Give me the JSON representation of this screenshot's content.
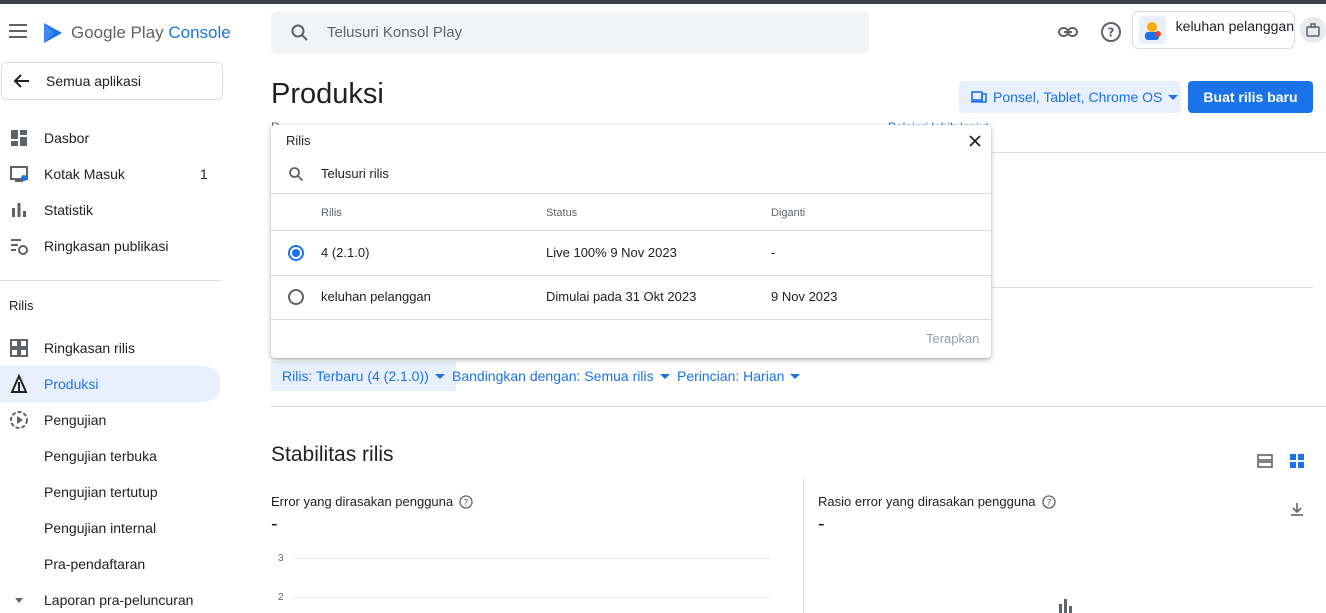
{
  "app": {
    "logo_text_main": "Google Play",
    "logo_text_accent": "Console"
  },
  "search": {
    "placeholder": "Telusuri Konsol Play"
  },
  "account": {
    "name": "keluhan pelanggan"
  },
  "sidebar": {
    "back_label": "Semua aplikasi",
    "items": [
      {
        "label": "Dasbor",
        "icon": "dashboard-icon"
      },
      {
        "label": "Kotak Masuk",
        "icon": "inbox-icon",
        "count": "1"
      },
      {
        "label": "Statistik",
        "icon": "statistics-icon"
      },
      {
        "label": "Ringkasan publikasi",
        "icon": "publishing-overview-icon"
      }
    ],
    "section_label": "Rilis",
    "release_items": [
      {
        "label": "Ringkasan rilis",
        "icon": "release-overview-icon"
      },
      {
        "label": "Produksi",
        "icon": "production-icon",
        "active": true
      },
      {
        "label": "Pengujian",
        "icon": "testing-icon"
      },
      {
        "label": "Pengujian terbuka"
      },
      {
        "label": "Pengujian tertutup"
      },
      {
        "label": "Pengujian internal"
      },
      {
        "label": "Pra-pendaftaran"
      },
      {
        "label": "Laporan pra-peluncuran",
        "icon": "expand-chevron-icon"
      }
    ]
  },
  "main": {
    "title": "Produksi",
    "device_filter": "Ponsel, Tablet, Chrome OS",
    "create_button": "Buat rilis baru",
    "description_fragment": "R",
    "description_link": "Pelajari lebih lanjut",
    "filters": [
      {
        "label": "Rilis: Terbaru (4 (2.1.0))",
        "selected": true
      },
      {
        "label": "Bandingkan dengan: Semua rilis"
      },
      {
        "label": "Perincian: Harian"
      }
    ],
    "section_title": "Stabilitas rilis",
    "metrics": [
      {
        "label": "Error yang dirasakan pengguna",
        "value": "-"
      },
      {
        "label": "Rasio error yang dirasakan pengguna",
        "value": "-"
      }
    ],
    "chart_ticks": [
      "3",
      "2"
    ]
  },
  "dropdown": {
    "title": "Rilis",
    "search_text": "Telusuri rilis",
    "columns": [
      "Rilis",
      "Status",
      "Diganti"
    ],
    "rows": [
      {
        "release": "4 (2.1.0)",
        "status": "Live 100% 9 Nov 2023",
        "replaced": "-",
        "selected": true
      },
      {
        "release": "keluhan pelanggan",
        "status": "Dimulai pada 31 Okt 2023",
        "replaced": "9 Nov 2023",
        "selected": false
      }
    ],
    "apply_label": "Terapkan"
  },
  "colors": {
    "accent": "#1a73e8",
    "accent_light": "#e8f0fe",
    "text": "#202124",
    "muted": "#5f6368"
  }
}
